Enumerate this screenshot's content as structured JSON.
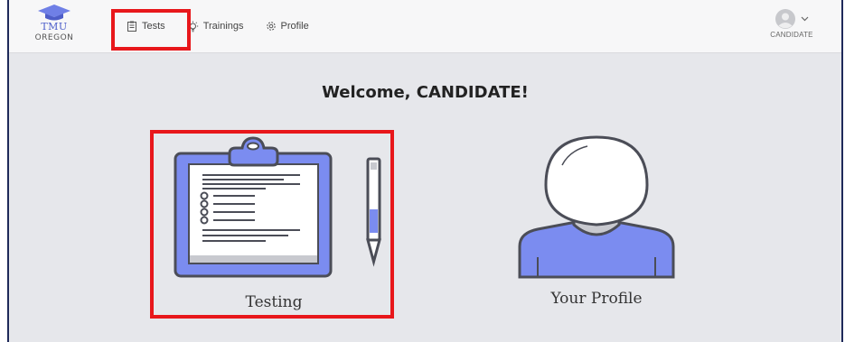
{
  "brand": {
    "line1": "TMU",
    "line2": "OREGON"
  },
  "nav": {
    "tests_label": "Tests",
    "trainings_label": "Trainings",
    "profile_label": "Profile"
  },
  "user": {
    "name": "CANDIDATE"
  },
  "welcome": "Welcome, CANDIDATE!",
  "cards": {
    "testing_label": "Testing",
    "profile_label": "Your Profile"
  },
  "colors": {
    "accent": "#7b8cf0",
    "highlight": "#e8171b",
    "avatar_body": "#7b8cf0",
    "outline": "#4b4d57"
  }
}
